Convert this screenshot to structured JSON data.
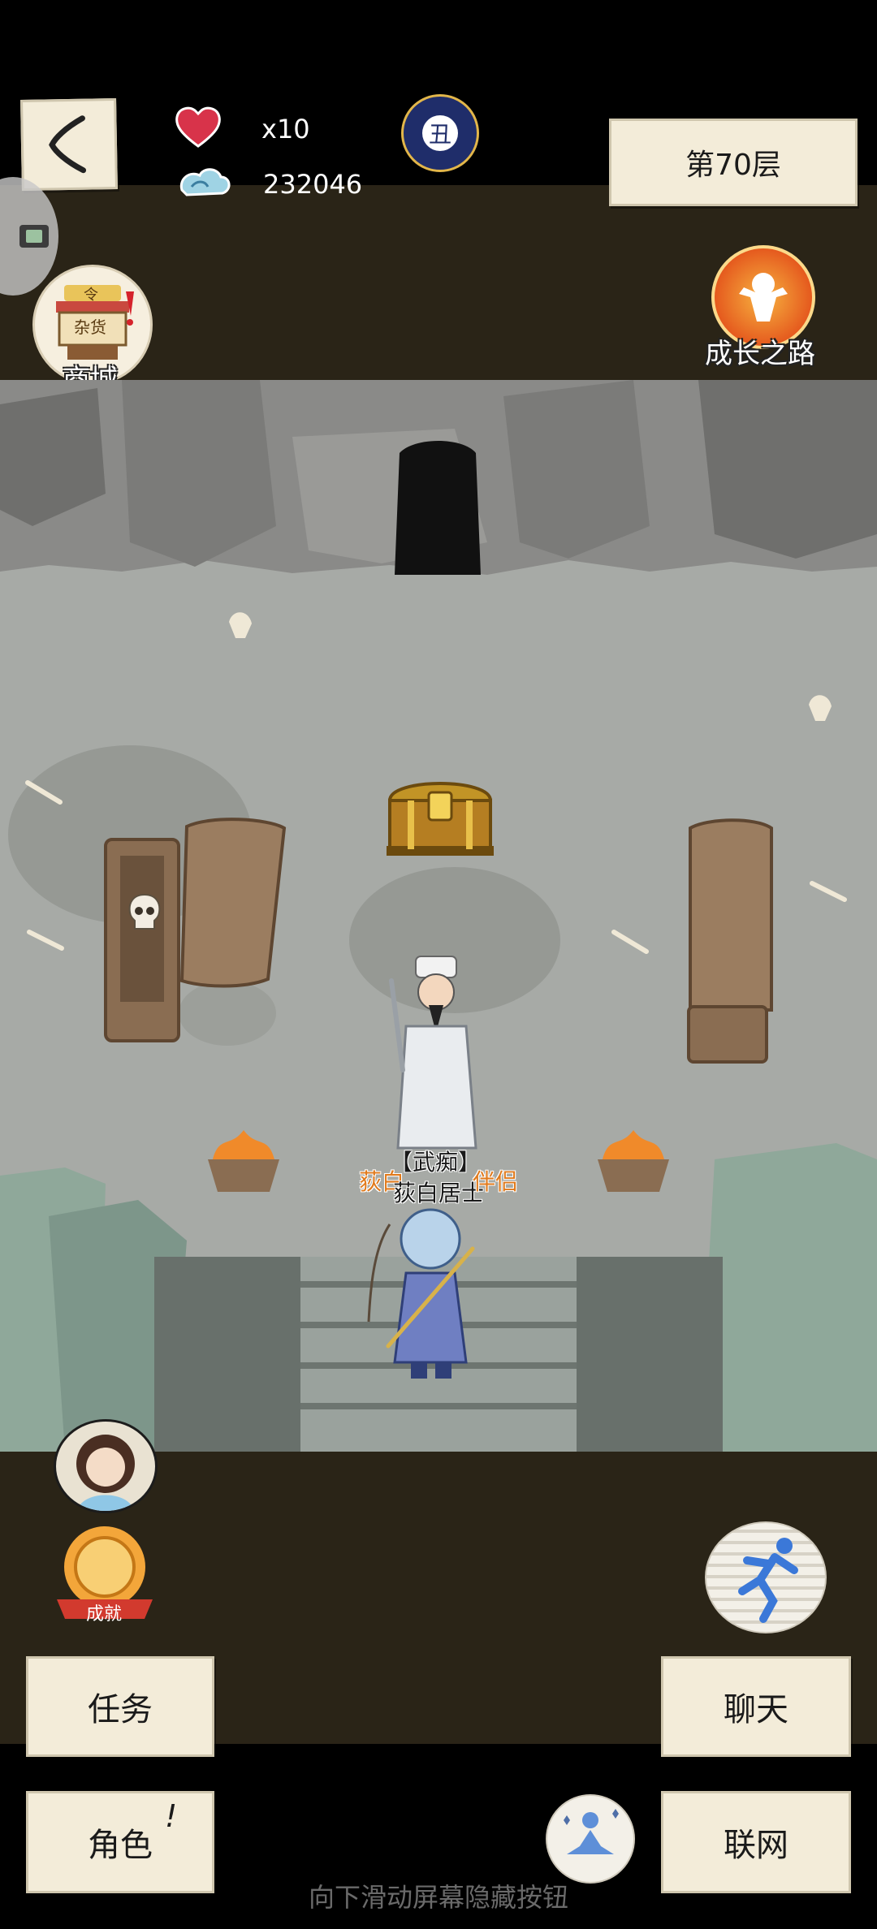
{
  "hud": {
    "lives_count": "x10",
    "currency_value": "232046",
    "floor_label": "第70层",
    "night_badge_char": "丑"
  },
  "side_buttons": {
    "shop_label": "商城",
    "shop_sign_top": "令",
    "shop_sign_main": "杂货",
    "growth_label": "成长之路",
    "achievement_label": "成就"
  },
  "scene": {
    "npc_title": "【武痴】",
    "npc_name": "荻白居士",
    "companion_tag_left": "荻白",
    "companion_tag_right": "伴侣"
  },
  "menu": {
    "task_label": "任务",
    "chat_label": "聊天",
    "role_label": "角色",
    "role_alert": "!",
    "network_label": "联网"
  },
  "hint_text": "向下滑动屏幕隐藏按钮",
  "colors": {
    "heart": "#d8334a",
    "name_orange": "#e07a1c",
    "paper": "#f3ecd9",
    "band": "#2a2417",
    "floor": "#a7aaa6"
  }
}
